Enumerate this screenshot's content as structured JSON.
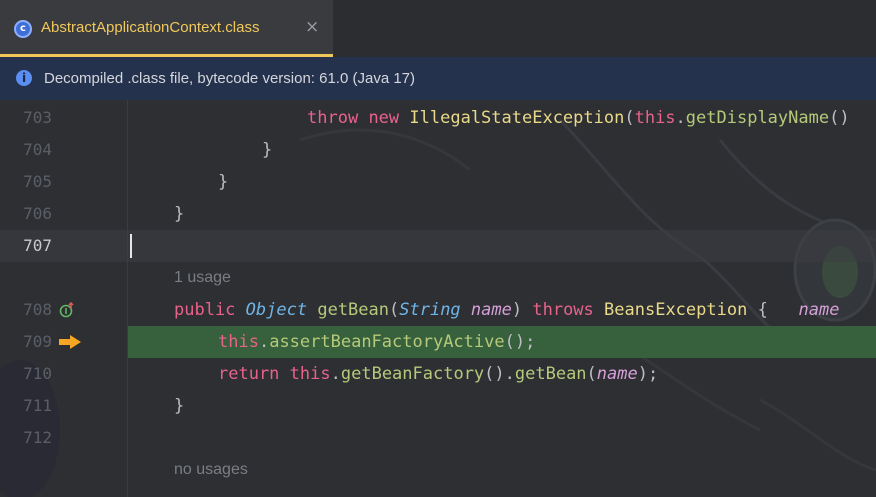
{
  "tab": {
    "title": "AbstractApplicationContext.class",
    "icon": "class-file-icon",
    "close": "×",
    "accent": "#f0c85a"
  },
  "banner": {
    "icon": "info-icon",
    "text": "Decompiled .class file, bytecode version: 61.0 (Java 17)"
  },
  "editor": {
    "lines": [
      {
        "num": "703",
        "tokens": [
          {
            "t": "kw",
            "v": "throw"
          },
          {
            "t": "pu",
            "v": " "
          },
          {
            "t": "kw",
            "v": "new"
          },
          {
            "t": "pu",
            "v": " "
          },
          {
            "t": "cls",
            "v": "IllegalStateException"
          },
          {
            "t": "pu",
            "v": "("
          },
          {
            "t": "kw",
            "v": "this"
          },
          {
            "t": "pu",
            "v": "."
          },
          {
            "t": "fn",
            "v": "getDisplayName"
          },
          {
            "t": "pu",
            "v": "()"
          }
        ]
      },
      {
        "num": "704",
        "tokens": [
          {
            "t": "pu",
            "v": "}"
          }
        ]
      },
      {
        "num": "705",
        "tokens": [
          {
            "t": "pu",
            "v": "}"
          }
        ]
      },
      {
        "num": "706",
        "tokens": [
          {
            "t": "pu",
            "v": "}"
          }
        ]
      },
      {
        "num": "707",
        "tokens": []
      },
      {
        "hint": "1 usage"
      },
      {
        "num": "708",
        "tokens": [
          {
            "t": "kw",
            "v": "public"
          },
          {
            "t": "pu",
            "v": " "
          },
          {
            "t": "ty",
            "v": "Object"
          },
          {
            "t": "pu",
            "v": " "
          },
          {
            "t": "fn",
            "v": "getBean"
          },
          {
            "t": "pu",
            "v": "("
          },
          {
            "t": "ty",
            "v": "String"
          },
          {
            "t": "pu",
            "v": " "
          },
          {
            "t": "pm",
            "v": "name"
          },
          {
            "t": "pu",
            "v": ") "
          },
          {
            "t": "kw",
            "v": "throws"
          },
          {
            "t": "pu",
            "v": " "
          },
          {
            "t": "cls",
            "v": "BeansException"
          },
          {
            "t": "pu",
            "v": " {   "
          },
          {
            "t": "ih",
            "v": "name"
          }
        ]
      },
      {
        "num": "709",
        "tokens": [
          {
            "t": "kw",
            "v": "this"
          },
          {
            "t": "pu",
            "v": "."
          },
          {
            "t": "fn",
            "v": "assertBeanFactoryActive"
          },
          {
            "t": "pu",
            "v": "();"
          }
        ]
      },
      {
        "num": "710",
        "tokens": [
          {
            "t": "kw",
            "v": "return"
          },
          {
            "t": "pu",
            "v": " "
          },
          {
            "t": "kw",
            "v": "this"
          },
          {
            "t": "pu",
            "v": "."
          },
          {
            "t": "fn",
            "v": "getBeanFactory"
          },
          {
            "t": "pu",
            "v": "()."
          },
          {
            "t": "fn",
            "v": "getBean"
          },
          {
            "t": "pu",
            "v": "("
          },
          {
            "t": "pm",
            "v": "name"
          },
          {
            "t": "pu",
            "v": ");"
          }
        ]
      },
      {
        "num": "711",
        "tokens": [
          {
            "t": "pu",
            "v": "}"
          }
        ]
      },
      {
        "num": "712",
        "tokens": []
      },
      {
        "hint": "no usages"
      }
    ]
  }
}
